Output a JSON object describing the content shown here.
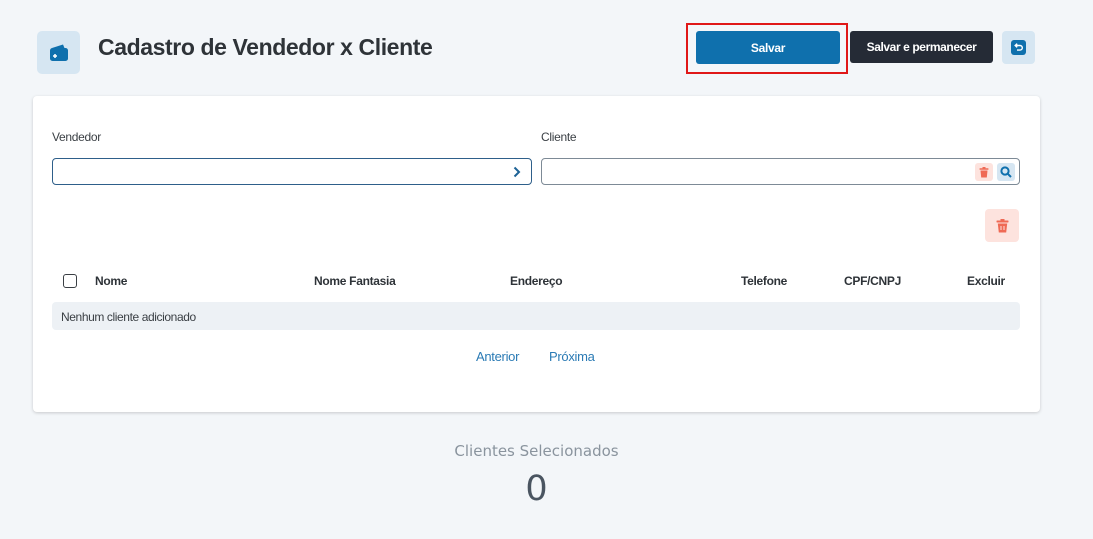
{
  "header": {
    "title": "Cadastro de Vendedor x Cliente",
    "icon": "wallet-icon"
  },
  "toolbar": {
    "save_label": "Salvar",
    "save_stay_label": "Salvar e permanecer",
    "back_icon": "undo-icon"
  },
  "form": {
    "vendedor_label": "Vendedor",
    "vendedor_value": "",
    "cliente_label": "Cliente",
    "cliente_value": ""
  },
  "table": {
    "columns": [
      "Nome",
      "Nome Fantasia",
      "Endereço",
      "Telefone",
      "CPF/CNPJ",
      "Excluir"
    ],
    "empty_message": "Nenhum cliente adicionado"
  },
  "pagination": {
    "prev_label": "Anterior",
    "next_label": "Próxima"
  },
  "summary": {
    "label": "Clientes Selecionados",
    "count": "0"
  },
  "colors": {
    "primary": "#0f70ad",
    "dark_button": "#252b36",
    "danger_soft": "#fde3de",
    "danger": "#ef6a55",
    "highlight_border": "#e01818"
  }
}
